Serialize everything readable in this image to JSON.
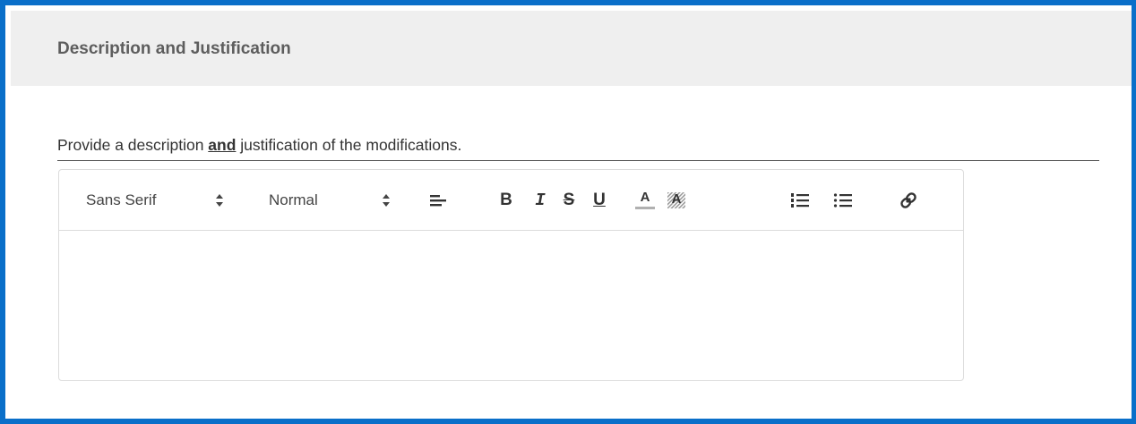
{
  "section": {
    "title": "Description and Justification"
  },
  "prompt": {
    "before": "Provide a description ",
    "emphasis": "and",
    "after": " justification of the modifications."
  },
  "editor": {
    "font_picker": {
      "selected": "Sans Serif"
    },
    "size_picker": {
      "selected": "Normal"
    },
    "toolbar": {
      "align": "align-left-icon",
      "bold": "B",
      "italic": "I",
      "strike": "S",
      "underline": "U",
      "color": "A",
      "background": "A",
      "ordered_list": "ordered-list-icon",
      "bullet_list": "bullet-list-icon",
      "link": "link-icon"
    },
    "content": ""
  },
  "colors": {
    "frame_border": "#0a6fc9",
    "header_bg": "#efefef",
    "header_text": "#5d5d5d"
  }
}
